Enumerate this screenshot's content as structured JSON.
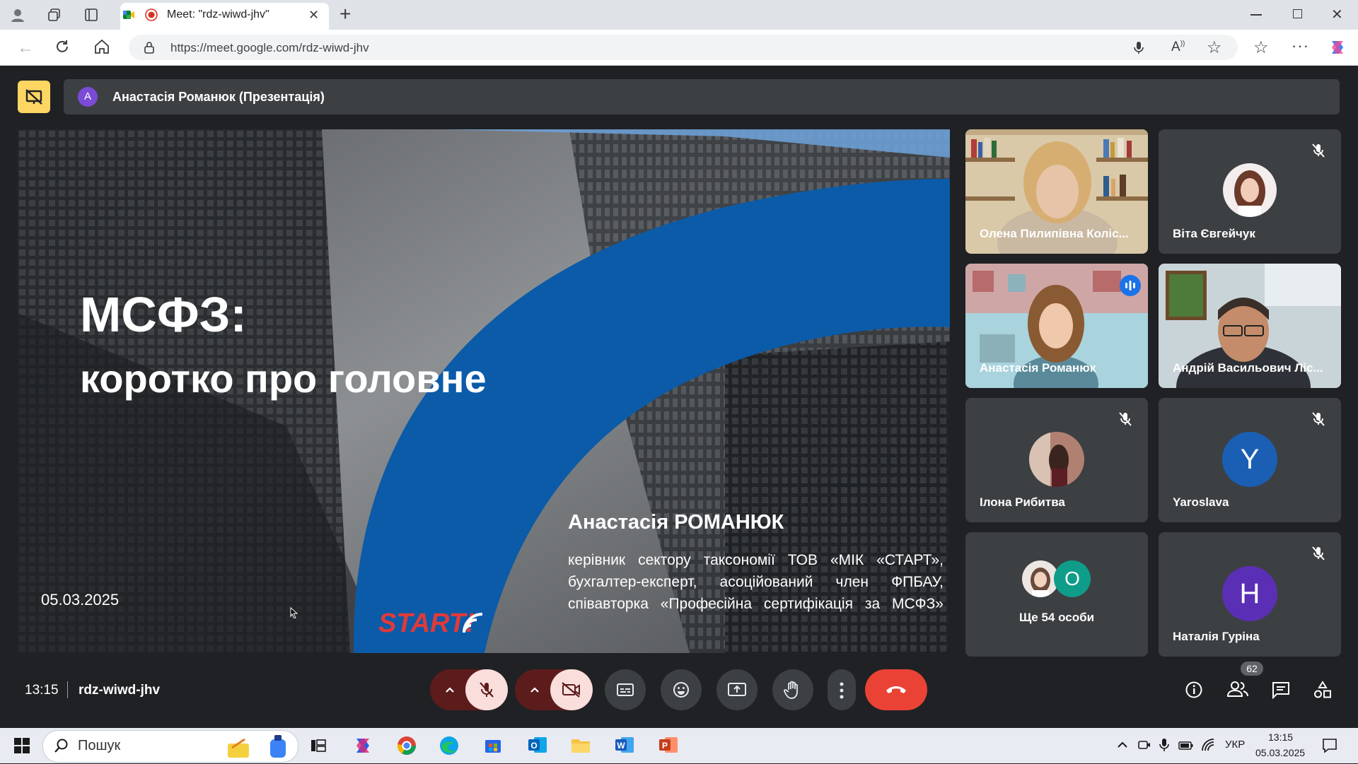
{
  "browser": {
    "tab_title": "Meet: \"rdz-wiwd-jhv\"",
    "url": "https://meet.google.com/rdz-wiwd-jhv"
  },
  "presentation_bar": {
    "avatar_letter": "A",
    "title": "Анастасія Романюк (Презентація)"
  },
  "slide": {
    "title_line1": "МСФЗ:",
    "title_line2": "коротко про головне",
    "speaker_name": "Анастасія РОМАНЮК",
    "speaker_desc_1": "керівник сектору таксономії ТОВ «МІК «СТАРТ»,",
    "speaker_desc_2": "бухгалтер-експерт, асоційований член ФПБАУ,",
    "speaker_desc_3": "співавторка «Професійна сертифікація за МСФЗ»",
    "date": "05.03.2025",
    "logo_text": "START!"
  },
  "participants": [
    {
      "name": "Олена Пилипівна Коліс...",
      "type": "video"
    },
    {
      "name": "Віта Євгейчук",
      "type": "photo",
      "muted": true
    },
    {
      "name": "Анастасія Романюк",
      "type": "video",
      "speaking": true
    },
    {
      "name": "Андрій Васильович Ліс...",
      "type": "video"
    },
    {
      "name": "Ілона Рибитва",
      "type": "photo",
      "muted": true
    },
    {
      "name": "Yaroslava",
      "type": "letter",
      "letter": "Y",
      "color": "#1a5fb4",
      "muted": true
    },
    {
      "name": "Ще 54 особи",
      "type": "more",
      "letter": "O",
      "color": "#0f9d8a"
    },
    {
      "name": "Наталія Гуріна",
      "type": "letter",
      "letter": "H",
      "color": "#5b2fb5",
      "muted": true
    }
  ],
  "bottom_bar": {
    "time": "13:15",
    "meeting_code": "rdz-wiwd-jhv",
    "people_count": "62"
  },
  "taskbar": {
    "search_placeholder": "Пошук",
    "lang": "УКР",
    "clock_time": "13:15",
    "clock_date": "05.03.2025"
  },
  "colors": {
    "end_call": "#ea4335",
    "muted_button": "#f9dedc",
    "accent_blue": "#8ab4f8",
    "slide_blue": "#0b5ba8"
  }
}
